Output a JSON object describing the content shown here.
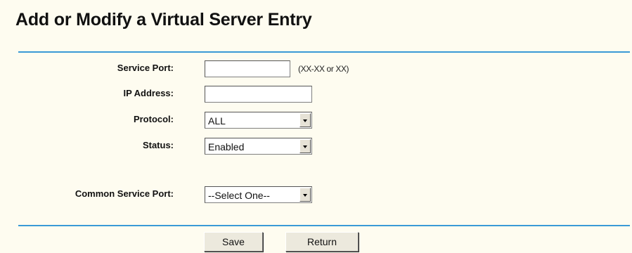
{
  "page": {
    "title": "Add or Modify a Virtual Server Entry"
  },
  "form": {
    "service_port": {
      "label": "Service Port:",
      "value": "",
      "hint": "(XX-XX or XX)"
    },
    "ip_address": {
      "label": "IP Address:",
      "value": ""
    },
    "protocol": {
      "label": "Protocol:",
      "selected": "ALL"
    },
    "status": {
      "label": "Status:",
      "selected": "Enabled"
    },
    "common_service_port": {
      "label": "Common Service Port:",
      "selected": "--Select One--"
    }
  },
  "buttons": {
    "save_label": "Save",
    "return_label": "Return"
  },
  "colors": {
    "background": "#fefcf0",
    "divider": "#3a9ad6"
  },
  "icons": {
    "dropdown_arrow": "chevron-down-icon"
  }
}
